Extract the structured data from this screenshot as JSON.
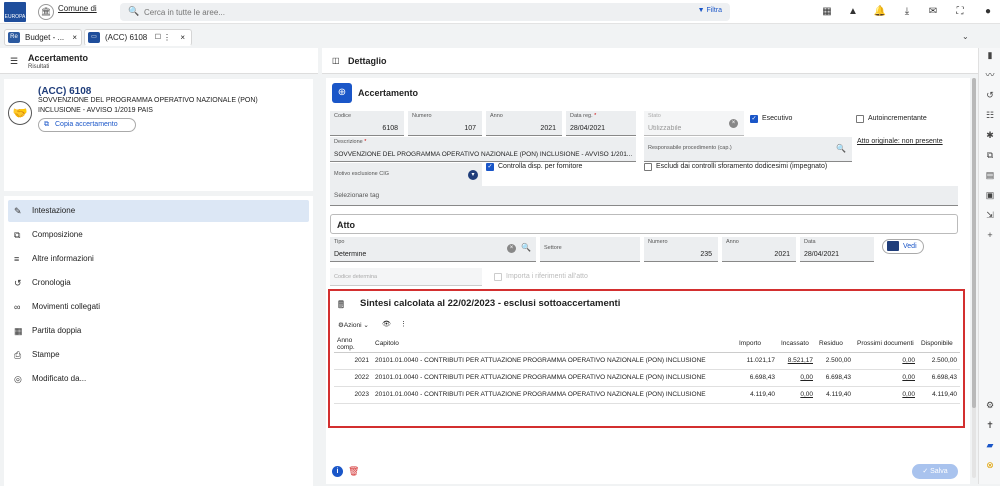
{
  "topbar": {
    "logo_text": "EUROPA",
    "ente_label": "Comune di",
    "search_placeholder": "Cerca in tutte le aree...",
    "filter_label": "Filtra"
  },
  "tabs": [
    {
      "icon": "Re",
      "label": "Budget - ...",
      "close": "×"
    },
    {
      "icon": "",
      "label": "(ACC) 6108",
      "close": "×"
    }
  ],
  "left": {
    "title": "Accertamento",
    "subtitle": "Risultati",
    "code": "(ACC) 6108",
    "desc_line1": "SOVVENZIONE DEL PROGRAMMA OPERATIVO NAZIONALE (PON)",
    "desc_line2": "INCLUSIONE - AVVISO 1/2019 PAIS",
    "copy_button": "Copia accertamento",
    "menu": [
      {
        "label": "Intestazione",
        "icon": "✎"
      },
      {
        "label": "Composizione",
        "icon": "⧉"
      },
      {
        "label": "Altre informazioni",
        "icon": "≡"
      },
      {
        "label": "Cronologia",
        "icon": "↺"
      },
      {
        "label": "Movimenti collegati",
        "icon": "∞"
      },
      {
        "label": "Partita doppia",
        "icon": "▦"
      },
      {
        "label": "Stampe",
        "icon": "⎙"
      },
      {
        "label": "Modificato da...",
        "icon": "◎"
      }
    ]
  },
  "right": {
    "title": "Dettaglio",
    "section": "Accertamento",
    "codice_label": "Codice",
    "codice": "6108",
    "numero_label": "Numero",
    "numero": "107",
    "anno_label": "Anno",
    "anno": "2021",
    "datareg_label": "Data reg.",
    "datareg": "28/04/2021",
    "stato_label": "Stato",
    "stato": "Utilizzabile",
    "esecutivo": "Esecutivo",
    "autoincrementante": "Autoincrementante",
    "descrizione_label": "Descrizione",
    "descrizione": "SOVVENZIONE DEL PROGRAMMA OPERATIVO NAZIONALE (PON) INCLUSIONE - AVVISO 1/201...",
    "responsabile_label": "Responsabile procedimento (cap.)",
    "atto_originale": "Atto originale: non presente",
    "motivo_label": "Motivo esclusione CIG",
    "controlla": "Controlla disp. per fornitore",
    "escludi": "Escludi dai controlli sforamento dodicesimi (impegnato)",
    "tag_placeholder": "Selezionare tag",
    "atto_title": "Atto",
    "tipo_label": "Tipo",
    "tipo": "Determine",
    "settore_label": "Settore",
    "atto_numero": "235",
    "atto_anno": "2021",
    "data_label": "Data",
    "atto_data": "28/04/2021",
    "vedi": "Vedi",
    "codice_determina": "Codice determina",
    "importa": "Importa i riferimenti all'atto",
    "salva": "Salva"
  },
  "sintesi": {
    "title": "Sintesi calcolata al 22/02/2023 - esclusi sottoaccertamenti",
    "azioni": "Azioni",
    "columns": [
      "Anno comp.",
      "Capitolo",
      "Importo",
      "Incassato",
      "Residuo",
      "Prossimi documenti",
      "Disponibile"
    ],
    "rows": [
      {
        "anno": "2021",
        "capitolo": "20101.01.0040 - CONTRIBUTI PER ATTUAZIONE PROGRAMMA OPERATIVO NAZIONALE (PON) INCLUSIONE",
        "importo": "11.021,17",
        "incassato": "8.521,17",
        "residuo": "2.500,00",
        "prossimi": "0,00",
        "disponibile": "2.500,00"
      },
      {
        "anno": "2022",
        "capitolo": "20101.01.0040 - CONTRIBUTI PER ATTUAZIONE PROGRAMMA OPERATIVO NAZIONALE (PON) INCLUSIONE",
        "importo": "6.698,43",
        "incassato": "0,00",
        "residuo": "6.698,43",
        "prossimi": "0,00",
        "disponibile": "6.698,43"
      },
      {
        "anno": "2023",
        "capitolo": "20101.01.0040 - CONTRIBUTI PER ATTUAZIONE PROGRAMMA OPERATIVO NAZIONALE (PON) INCLUSIONE",
        "importo": "4.119,40",
        "incassato": "0,00",
        "residuo": "4.119,40",
        "prossimi": "0,00",
        "disponibile": "4.119,40"
      }
    ]
  },
  "colors": {
    "accent": "#1a56c8",
    "highlight_border": "#d32f2f",
    "active_menu": "#dce7f5"
  }
}
